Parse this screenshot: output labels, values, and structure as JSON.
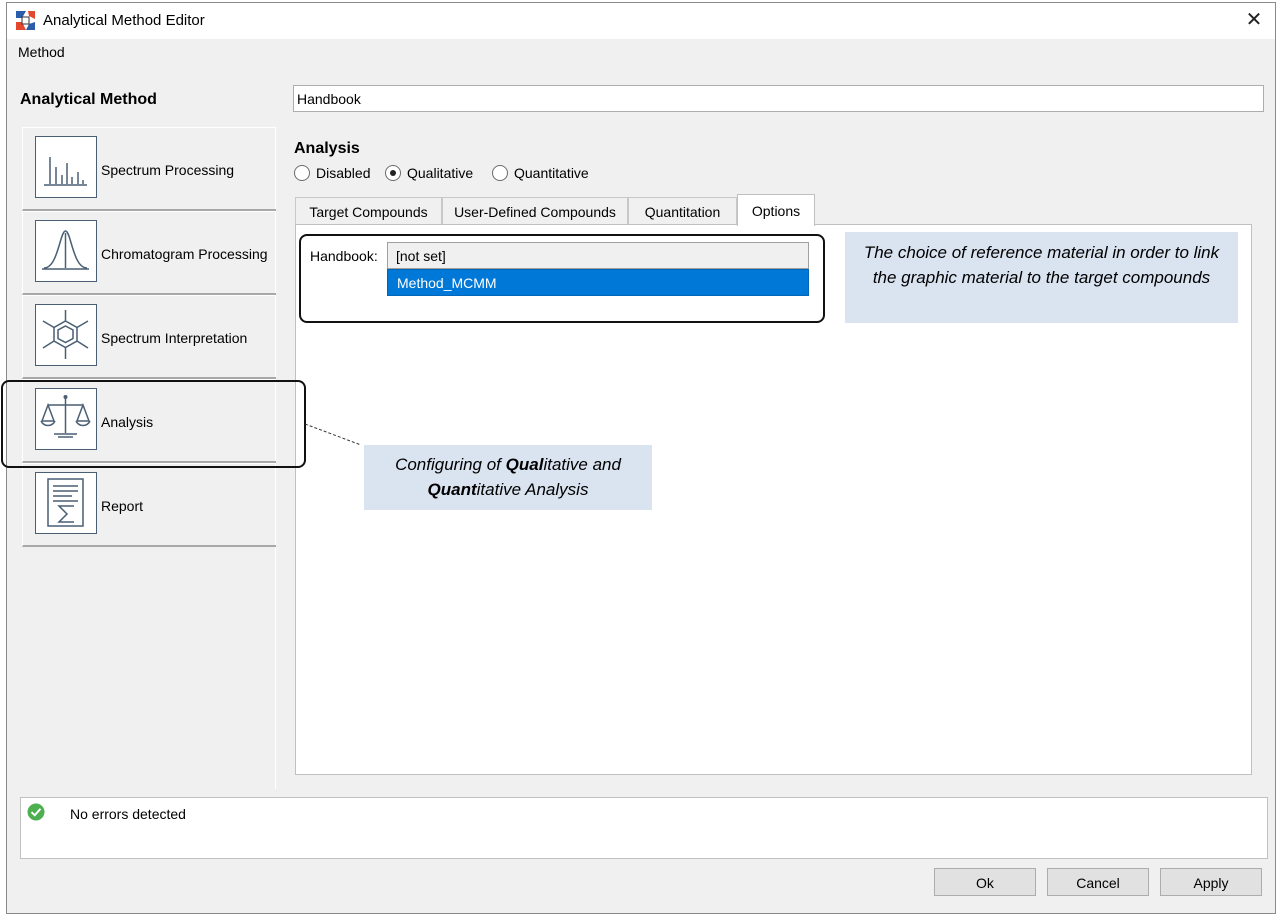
{
  "window": {
    "title": "Analytical Method Editor",
    "close_glyph": "✕"
  },
  "menu": {
    "items": [
      "Method"
    ]
  },
  "nav": {
    "title": "Analytical Method",
    "items": [
      {
        "label": "Spectrum Processing",
        "icon": "spectrum-icon"
      },
      {
        "label": "Chromatogram Processing",
        "icon": "chromatogram-icon"
      },
      {
        "label": "Spectrum Interpretation",
        "icon": "molecule-icon"
      },
      {
        "label": "Analysis",
        "icon": "scale-icon"
      },
      {
        "label": "Report",
        "icon": "sigma-report-icon"
      }
    ]
  },
  "main": {
    "name_value": "Handbook",
    "section_title": "Analysis",
    "radios": [
      {
        "label": "Disabled",
        "checked": false
      },
      {
        "label": "Qualitative",
        "checked": true
      },
      {
        "label": "Quantitative",
        "checked": false
      }
    ],
    "tabs": [
      {
        "label": "Target Compounds",
        "active": false
      },
      {
        "label": "User-Defined Compounds",
        "active": false
      },
      {
        "label": "Quantitation",
        "active": false
      },
      {
        "label": "Options",
        "active": true
      }
    ],
    "handbook_label": "Handbook:",
    "handbook_value": "[not set]",
    "dropdown_options": [
      "Method_MCMM"
    ]
  },
  "annotations": {
    "note_1": "The choice of reference material in order to link the graphic material to the target compounds",
    "note_2": {
      "part1": "Configuring of ",
      "bold1": "Qual",
      "part2": "itative and ",
      "bold2": "Quant",
      "part3": "itative Analysis"
    }
  },
  "status": {
    "text": "No errors detected",
    "icon": "check-circle-icon",
    "color": "#4caf50"
  },
  "buttons": {
    "ok": "Ok",
    "cancel": "Cancel",
    "apply": "Apply"
  },
  "colors": {
    "selection": "#0078d7",
    "note_bg": "#dae3f0",
    "icon_stroke": "#4a5f74"
  }
}
